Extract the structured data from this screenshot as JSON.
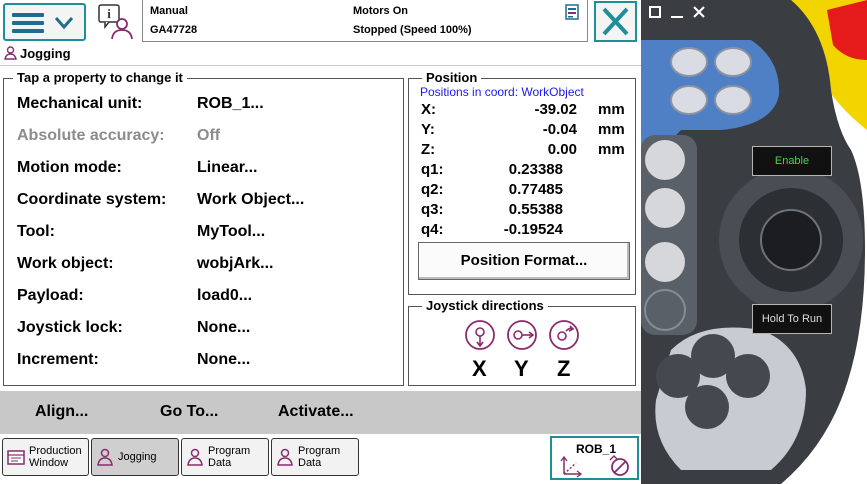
{
  "topbar": {
    "mode": "Manual",
    "controller": "GA47728",
    "motors": "Motors On",
    "state": "Stopped (Speed 100%)"
  },
  "app": {
    "title": "Jogging"
  },
  "properties": {
    "title": "Tap a property to change it",
    "rows": [
      {
        "label": "Mechanical unit:",
        "value": "ROB_1...",
        "enabled": true
      },
      {
        "label": "Absolute accuracy:",
        "value": "Off",
        "enabled": false
      },
      {
        "label": "Motion mode:",
        "value": "Linear...",
        "enabled": true
      },
      {
        "label": "Coordinate system:",
        "value": "Work Object...",
        "enabled": true
      },
      {
        "label": "Tool:",
        "value": "MyTool...",
        "enabled": true
      },
      {
        "label": "Work object:",
        "value": "wobjArk...",
        "enabled": true
      },
      {
        "label": "Payload:",
        "value": "load0...",
        "enabled": true
      },
      {
        "label": "Joystick lock:",
        "value": "None...",
        "enabled": true
      },
      {
        "label": "Increment:",
        "value": "None...",
        "enabled": true
      }
    ]
  },
  "position": {
    "title": "Position",
    "note": "Positions in coord: WorkObject",
    "linear": [
      {
        "key": "X:",
        "value": "-39.02",
        "unit": "mm"
      },
      {
        "key": "Y:",
        "value": "-0.04",
        "unit": "mm"
      },
      {
        "key": "Z:",
        "value": "0.00",
        "unit": "mm"
      }
    ],
    "quaternion": [
      {
        "key": "q1:",
        "value": "0.23388"
      },
      {
        "key": "q2:",
        "value": "0.77485"
      },
      {
        "key": "q3:",
        "value": "0.55388"
      },
      {
        "key": "q4:",
        "value": "-0.19524"
      }
    ],
    "format_button": "Position Format..."
  },
  "joystick": {
    "title": "Joystick directions",
    "axes": [
      "X",
      "Y",
      "Z"
    ]
  },
  "commands": [
    "Align...",
    "Go To...",
    "Activate..."
  ],
  "tasks": [
    {
      "label_1": "Production",
      "label_2": "Window",
      "active": false
    },
    {
      "label_1": "Jogging",
      "label_2": "",
      "active": true
    },
    {
      "label_1": "Program",
      "label_2": "Data",
      "active": false
    },
    {
      "label_1": "Program",
      "label_2": "Data",
      "active": false
    }
  ],
  "quickset": {
    "unit": "ROB_1"
  },
  "device": {
    "enable": "Enable",
    "hold_to_run": "Hold To Run"
  },
  "colors": {
    "accent": "#1e8f9a",
    "disabled_text": "#8c8c8c",
    "coord_note": "#1a1aee",
    "command_bar": "#c8c8c8",
    "device_body": "#3a3d42",
    "device_blue": "#4f7fc4",
    "device_yellow": "#f2d400",
    "device_red": "#e51a1a"
  },
  "icons": [
    "menu-icon",
    "chevron-down-icon",
    "user-info-icon",
    "event-log-icon",
    "close-icon",
    "jogging-icon",
    "joystick-x-icon",
    "joystick-y-icon",
    "joystick-z-icon",
    "production-window-icon",
    "program-data-icon",
    "quickset-icon",
    "emergency-stop-icon"
  ]
}
